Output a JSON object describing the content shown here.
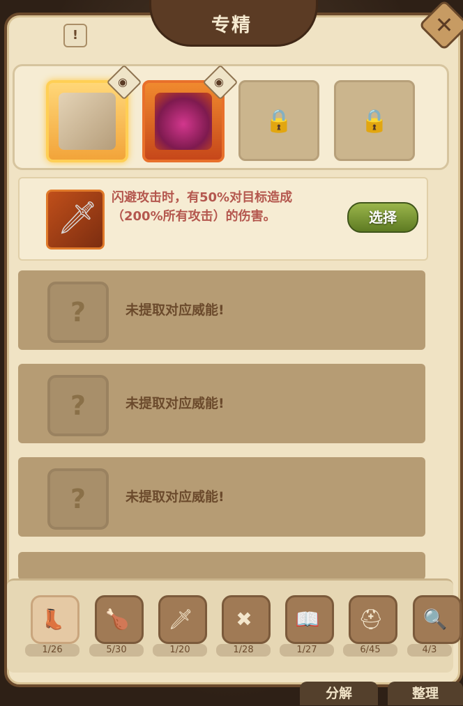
{
  "header": {
    "title": "专精",
    "info_icon_text": "!",
    "close_icon_text": "✕"
  },
  "slots": [
    {
      "state": "selected",
      "art": "stone-pillar-art",
      "eye_icon": "eye-icon"
    },
    {
      "state": "unlocked",
      "art": "crystal-feathers-art",
      "eye_icon": "eye-icon"
    },
    {
      "state": "locked",
      "icon": "lock-icon",
      "glyph": "🔒"
    },
    {
      "state": "locked",
      "icon": "lock-icon",
      "glyph": "🔒"
    }
  ],
  "active_ability": {
    "icon": "dagger-icon",
    "glyph": "🗡",
    "description_line1": "闪避攻击时，有50%对目标造成",
    "description_line2": "（200%所有攻击）的伤害。",
    "select_label": "选择"
  },
  "empty_abilities": [
    {
      "question": "?",
      "text": "未提取对应威能!"
    },
    {
      "question": "?",
      "text": "未提取对应威能!"
    },
    {
      "question": "?",
      "text": "未提取对应威能!"
    }
  ],
  "categories": [
    {
      "icon": "boot-icon",
      "glyph": "👢",
      "count": "1/26",
      "active": true
    },
    {
      "icon": "drumstick-icon",
      "glyph": "🍗",
      "count": "5/30",
      "active": false
    },
    {
      "icon": "sword-icon",
      "glyph": "🗡",
      "count": "1/20",
      "active": false
    },
    {
      "icon": "shield-icon",
      "glyph": "✖",
      "count": "1/28",
      "active": false
    },
    {
      "icon": "book-icon",
      "glyph": "📖",
      "count": "1/27",
      "active": false
    },
    {
      "icon": "helmet-icon",
      "glyph": "⛑",
      "count": "6/45",
      "active": false
    },
    {
      "icon": "magnifier-icon",
      "glyph": "🔍",
      "count": "4/3",
      "active": false
    }
  ],
  "footer": {
    "decompose_label": "分解",
    "organize_label": "整理"
  }
}
